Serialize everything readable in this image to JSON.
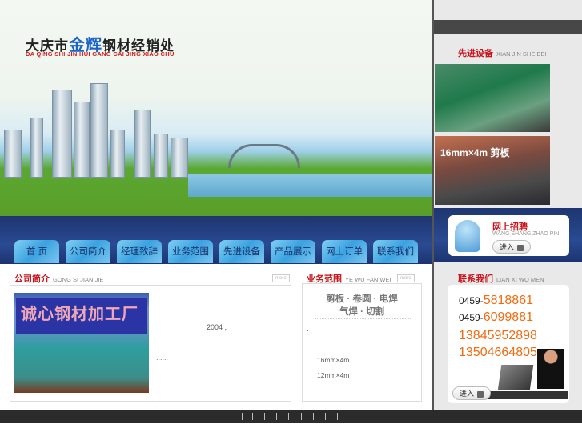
{
  "header": {
    "company_cn_prefix": "大庆市",
    "company_cn_brand": "金辉",
    "company_cn_suffix": "钢材经销处",
    "company_pinyin": "DA QING SHI JIN HUI GANG CAI JING XIAO CHU"
  },
  "nav": [
    "首 页",
    "公司简介",
    "经理致辞",
    "业务范围",
    "先进设备",
    "产品展示",
    "网上订单",
    "联系我们"
  ],
  "about": {
    "title": "公司简介",
    "pinyin": "GONG SI JIAN JIE",
    "more": "more",
    "sign_text": "诚心钢材加工厂",
    "year": "2004 ,",
    "ellipsis": "......"
  },
  "business": {
    "title": "业务范围",
    "pinyin": "YE WU FAN WEI",
    "more": "more",
    "line1": "剪板 · 卷圆 · 电焊",
    "line2": "气焊 · 切割",
    "items": [
      "·",
      "·",
      "16mm×4m",
      "12mm×4m",
      "·"
    ]
  },
  "equipment": {
    "title": "先进设备",
    "pinyin": "XIAN JIN SHE BEI",
    "photo_text": "16mm×4m 剪板"
  },
  "recruit": {
    "title": "网上招聘",
    "pinyin": "WANG SHANG ZHAO PIN",
    "enter": "进入"
  },
  "contact": {
    "title": "联系我们",
    "pinyin": "LIAN XI WO MEN",
    "phones": [
      {
        "area": "0459-",
        "num": "5818861"
      },
      {
        "area": "0459-",
        "num": "6099881"
      }
    ],
    "mobiles": [
      "13845952898",
      "13504664805"
    ],
    "enter": "进入"
  },
  "colors": {
    "accent_red": "#c8161d",
    "orange": "#f26b0f",
    "nav_blue": "#3aa2e0"
  }
}
